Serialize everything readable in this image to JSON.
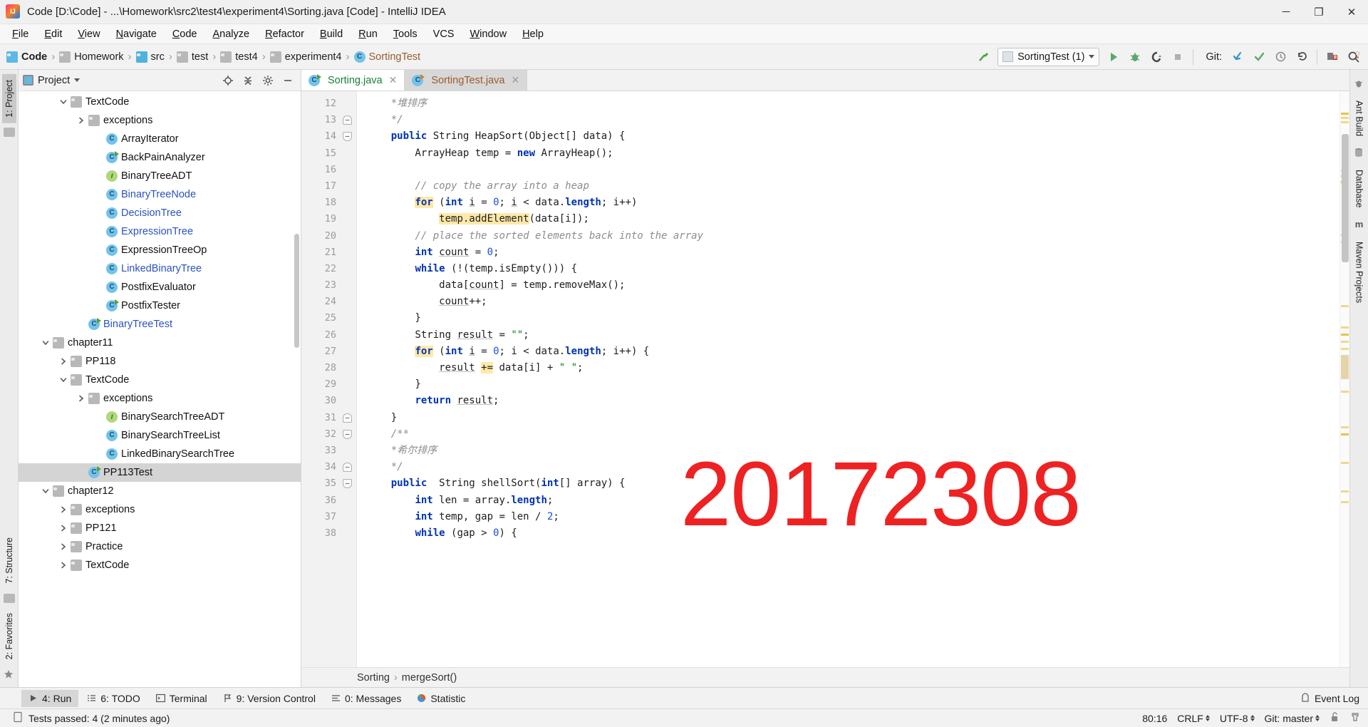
{
  "window": {
    "title": "Code [D:\\Code] - ...\\Homework\\src2\\test4\\experiment4\\Sorting.java [Code] - IntelliJ IDEA",
    "minimize": "─",
    "maximize": "❐",
    "close": "✕"
  },
  "menu": [
    "File",
    "Edit",
    "View",
    "Navigate",
    "Code",
    "Analyze",
    "Refactor",
    "Build",
    "Run",
    "Tools",
    "VCS",
    "Window",
    "Help"
  ],
  "breadcrumbs": [
    {
      "label": "Code",
      "icon": "module-icon",
      "bold": true
    },
    {
      "label": "Homework",
      "icon": "folder-icon",
      "bold": false
    },
    {
      "label": "src",
      "icon": "source-folder-icon",
      "bold": false
    },
    {
      "label": "test",
      "icon": "folder-icon",
      "bold": false
    },
    {
      "label": "test4",
      "icon": "folder-icon",
      "bold": false
    },
    {
      "label": "experiment4",
      "icon": "folder-icon",
      "bold": false
    },
    {
      "label": "SortingTest",
      "icon": "class-icon",
      "bold": false
    }
  ],
  "toolbar": {
    "run_config": "SortingTest (1)",
    "git_label": "Git:",
    "buttons": [
      "build-hammer-icon",
      "run-icon",
      "debug-icon",
      "run-coverage-icon",
      "stop-icon"
    ],
    "git_buttons": [
      "update-project-icon",
      "commit-icon",
      "history-icon",
      "rollback-icon"
    ],
    "right_buttons": [
      "settings-icon",
      "search-everywhere-icon"
    ]
  },
  "project_panel": {
    "title": "Project",
    "header_buttons": [
      "locate-icon",
      "collapse-all-icon",
      "settings-gear-icon",
      "hide-icon"
    ],
    "tree": [
      {
        "label": "TextCode",
        "indent": 3,
        "twist": "down",
        "icon": "folder-icon",
        "modified": false,
        "selected": false
      },
      {
        "label": "exceptions",
        "indent": 4,
        "twist": "right",
        "icon": "folder-icon",
        "modified": false,
        "selected": false
      },
      {
        "label": "ArrayIterator",
        "indent": 5,
        "twist": "none",
        "icon": "class-icon",
        "modified": false,
        "selected": false
      },
      {
        "label": "BackPainAnalyzer",
        "indent": 5,
        "twist": "none",
        "icon": "class-run-icon",
        "modified": false,
        "selected": false
      },
      {
        "label": "BinaryTreeADT",
        "indent": 5,
        "twist": "none",
        "icon": "interface-icon",
        "modified": false,
        "selected": false
      },
      {
        "label": "BinaryTreeNode",
        "indent": 5,
        "twist": "none",
        "icon": "class-icon",
        "modified": true,
        "selected": false
      },
      {
        "label": "DecisionTree",
        "indent": 5,
        "twist": "none",
        "icon": "class-icon",
        "modified": true,
        "selected": false
      },
      {
        "label": "ExpressionTree",
        "indent": 5,
        "twist": "none",
        "icon": "class-icon",
        "modified": true,
        "selected": false
      },
      {
        "label": "ExpressionTreeOp",
        "indent": 5,
        "twist": "none",
        "icon": "class-icon",
        "modified": false,
        "selected": false
      },
      {
        "label": "LinkedBinaryTree",
        "indent": 5,
        "twist": "none",
        "icon": "class-icon",
        "modified": true,
        "selected": false
      },
      {
        "label": "PostfixEvaluator",
        "indent": 5,
        "twist": "none",
        "icon": "class-icon",
        "modified": false,
        "selected": false
      },
      {
        "label": "PostfixTester",
        "indent": 5,
        "twist": "none",
        "icon": "class-run-icon",
        "modified": false,
        "selected": false
      },
      {
        "label": "BinaryTreeTest",
        "indent": 4,
        "twist": "none",
        "icon": "class-run-icon",
        "modified": true,
        "selected": false
      },
      {
        "label": "chapter11",
        "indent": 2,
        "twist": "down",
        "icon": "folder-icon",
        "modified": false,
        "selected": false
      },
      {
        "label": "PP118",
        "indent": 3,
        "twist": "right",
        "icon": "folder-icon",
        "modified": false,
        "selected": false
      },
      {
        "label": "TextCode",
        "indent": 3,
        "twist": "down",
        "icon": "folder-icon",
        "modified": false,
        "selected": false
      },
      {
        "label": "exceptions",
        "indent": 4,
        "twist": "right",
        "icon": "folder-icon",
        "modified": false,
        "selected": false
      },
      {
        "label": "BinarySearchTreeADT",
        "indent": 5,
        "twist": "none",
        "icon": "interface-icon",
        "modified": false,
        "selected": false
      },
      {
        "label": "BinarySearchTreeList",
        "indent": 5,
        "twist": "none",
        "icon": "class-icon",
        "modified": false,
        "selected": false
      },
      {
        "label": "LinkedBinarySearchTree",
        "indent": 5,
        "twist": "none",
        "icon": "class-icon",
        "modified": false,
        "selected": false
      },
      {
        "label": "PP113Test",
        "indent": 4,
        "twist": "none",
        "icon": "class-run-icon",
        "modified": false,
        "selected": true
      },
      {
        "label": "chapter12",
        "indent": 2,
        "twist": "down",
        "icon": "folder-icon",
        "modified": false,
        "selected": false
      },
      {
        "label": "exceptions",
        "indent": 3,
        "twist": "right",
        "icon": "folder-icon",
        "modified": false,
        "selected": false
      },
      {
        "label": "PP121",
        "indent": 3,
        "twist": "right",
        "icon": "folder-icon",
        "modified": false,
        "selected": false
      },
      {
        "label": "Practice",
        "indent": 3,
        "twist": "right",
        "icon": "folder-icon",
        "modified": false,
        "selected": false
      },
      {
        "label": "TextCode",
        "indent": 3,
        "twist": "right",
        "icon": "folder-icon",
        "modified": false,
        "selected": false
      }
    ]
  },
  "editor": {
    "tabs": [
      {
        "label": "Sorting.java",
        "icon": "class-run-icon",
        "active": true,
        "color": "green"
      },
      {
        "label": "SortingTest.java",
        "icon": "class-test-icon",
        "active": false,
        "color": "brown"
      }
    ],
    "first_line": 12,
    "lines": [
      {
        "n": 12,
        "fold": "",
        "html": "    <span class='cmt'>*堆排序</span>"
      },
      {
        "n": 13,
        "fold": "minus-top",
        "html": "    <span class='cmt'>*/</span>"
      },
      {
        "n": 14,
        "fold": "minus-bot",
        "html": "    <span class='kw'>public</span> String HeapSort(Object[] data) {"
      },
      {
        "n": 15,
        "fold": "",
        "html": "        ArrayHeap temp = <span class='kw'>new</span> ArrayHeap();"
      },
      {
        "n": 16,
        "fold": "",
        "html": ""
      },
      {
        "n": 17,
        "fold": "",
        "html": "        <span class='cmt'>// copy the array into a heap</span>"
      },
      {
        "n": 18,
        "fold": "",
        "html": "        <span class='kw hl'>for</span> (<span class='kw'>int</span> <span class='undl'>i</span> = <span class='num'>0</span>; <span class='undl'>i</span> &lt; data.<span class='kw'>length</span>; i++)"
      },
      {
        "n": 19,
        "fold": "",
        "html": "            <span class='hl'>temp.addElement</span>(data[i]);"
      },
      {
        "n": 20,
        "fold": "",
        "html": "        <span class='cmt'>// place the sorted elements back into the array</span>"
      },
      {
        "n": 21,
        "fold": "",
        "html": "        <span class='kw'>int</span> <span class='undl'>count</span> = <span class='num'>0</span>;"
      },
      {
        "n": 22,
        "fold": "",
        "html": "        <span class='kw'>while</span> (!(temp.isEmpty())) {"
      },
      {
        "n": 23,
        "fold": "",
        "html": "            data[<span class='undl'>count</span>] = temp.removeMax();"
      },
      {
        "n": 24,
        "fold": "",
        "html": "            <span class='undl'>count</span>++;"
      },
      {
        "n": 25,
        "fold": "",
        "html": "        }"
      },
      {
        "n": 26,
        "fold": "",
        "html": "        String <span class='undl'>result</span> = <span class='str'>\"\"</span>;"
      },
      {
        "n": 27,
        "fold": "",
        "html": "        <span class='kw hl'>for</span> (<span class='kw'>int</span> <span class='undl'>i</span> = <span class='num'>0</span>; i &lt; data.<span class='kw'>length</span>; i++) {"
      },
      {
        "n": 28,
        "fold": "",
        "html": "            <span class='undl'>result</span> <span class='hl'>+=</span> data[i] + <span class='str'>\" \"</span>;"
      },
      {
        "n": 29,
        "fold": "",
        "html": "        }"
      },
      {
        "n": 30,
        "fold": "",
        "html": "        <span class='kw'>return</span> <span class='undl'>result</span>;"
      },
      {
        "n": 31,
        "fold": "minus-top",
        "html": "    }"
      },
      {
        "n": 32,
        "fold": "minus-bot",
        "html": "    <span class='cmt'>/**</span>"
      },
      {
        "n": 33,
        "fold": "",
        "html": "    <span class='cmt'>*希尔排序</span>"
      },
      {
        "n": 34,
        "fold": "minus-top",
        "html": "    <span class='cmt'>*/</span>"
      },
      {
        "n": 35,
        "fold": "minus-bot",
        "html": "    <span class='kw'>public</span>  String shellSort(<span class='kw'>int</span>[] array) {"
      },
      {
        "n": 36,
        "fold": "",
        "html": "        <span class='kw'>int</span> len = array.<span class='kw'>length</span>;"
      },
      {
        "n": 37,
        "fold": "",
        "html": "        <span class='kw'>int</span> temp, gap = len / <span class='num'>2</span>;"
      },
      {
        "n": 38,
        "fold": "",
        "html": "        <span class='kw'>while</span> (gap &gt; <span class='num'>0</span>) {"
      }
    ],
    "breadcrumb": [
      "Sorting",
      "mergeSort()"
    ],
    "breadcrumb_sep": "›"
  },
  "left_strip": {
    "tabs": [
      {
        "label": "1: Project",
        "active": true
      },
      {
        "label": "7: Structure",
        "active": false
      },
      {
        "label": "2: Favorites",
        "active": false
      }
    ]
  },
  "right_strip": {
    "tabs": [
      "Ant Build",
      "Database",
      "Maven Projects"
    ]
  },
  "tool_windows": {
    "items": [
      {
        "label": "4: Run",
        "icon": "run-icon",
        "active": true
      },
      {
        "label": "6: TODO",
        "icon": "todo-icon",
        "active": false
      },
      {
        "label": "Terminal",
        "icon": "terminal-icon",
        "active": false
      },
      {
        "label": "9: Version Control",
        "icon": "vcs-icon",
        "active": false
      },
      {
        "label": "0: Messages",
        "icon": "messages-icon",
        "active": false
      },
      {
        "label": "Statistic",
        "icon": "statistic-icon",
        "active": false
      }
    ],
    "event_log": "Event Log"
  },
  "status_bar": {
    "message": "Tests passed: 4 (2 minutes ago)",
    "caret_position": "80:16",
    "line_separator": "CRLF",
    "encoding": "UTF-8",
    "branch": "Git: master"
  },
  "watermark": "20172308",
  "colors": {
    "accent_green": "#1a7f37",
    "accent_brown": "#9a5b2f",
    "modified_blue": "#2b52c4",
    "watermark_red": "#ee2222",
    "keyword_blue": "#0033b3",
    "string_green": "#067d17",
    "highlight_yellow": "#ffe9a8"
  }
}
